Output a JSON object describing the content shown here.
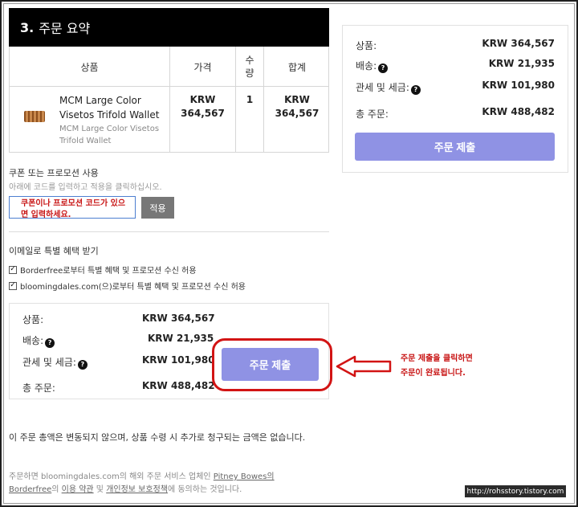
{
  "section": {
    "number": "3.",
    "title": "주문 요약"
  },
  "table": {
    "headers": {
      "product": "상품",
      "price": "가격",
      "qty_1": "수",
      "qty_2": "량",
      "total": "합계"
    },
    "row": {
      "name": "MCM Large Color Visetos Trifold Wallet",
      "subtitle": "MCM Large Color Visetos Trifold Wallet",
      "price_1": "KRW",
      "price_2": "364,567",
      "qty": "1",
      "total_1": "KRW",
      "total_2": "364,567"
    }
  },
  "coupon": {
    "title": "쿠폰 또는 프로모션 사용",
    "desc": "아래에 코드를 입력하고 적용을 클릭하십시오.",
    "input_annotation": "쿠폰이나 프로모션 코드가 있으면 입력하세요.",
    "apply_label": "적용"
  },
  "email": {
    "title": "이메일로 특별 혜택 받기",
    "opt1": "Borderfree로부터 특별 혜택 및 프로모션 수신 허용",
    "opt2": "bloomingdales.com(으)로부터 특별 혜택 및 프로모션 수신 허용"
  },
  "summary": {
    "items_label": "상품:",
    "items_value": "KRW 364,567",
    "shipping_label": "배송:",
    "shipping_value": "KRW 21,935",
    "duties_label": "관세 및 세금:",
    "duties_value": "KRW 101,980",
    "total_label": "총 주문:",
    "total_value": "KRW 488,482",
    "submit_label": "주문 제출"
  },
  "annotation": {
    "line1": "주문 제출을 클릭하면",
    "line2": "주문이 완료됩니다."
  },
  "footer": {
    "note": "이 주문 총액은 변동되지 않으며, 상품 수령 시 추가로 청구되는 금액은 없습니다.",
    "legal_1": "주문하면 bloomingdales.com의 해외 주문 서비스 업체인 ",
    "link_pitney": "Pitney Bowes의",
    "link_borderfree": "Borderfree",
    "legal_2": "의 ",
    "link_terms": "이용 약관",
    "legal_3": " 및 ",
    "link_privacy": "개인정보 보호정책",
    "legal_4": "에 동의하는 것입니다."
  },
  "watermark": "http://rohsstory.tistory.com",
  "colors": {
    "submit": "#8f92e4",
    "highlight": "#d21414",
    "header_bg": "#000000"
  }
}
